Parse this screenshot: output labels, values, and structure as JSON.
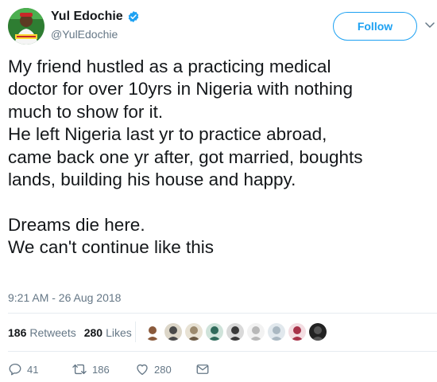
{
  "tweet": {
    "display_name": "Yul Edochie",
    "handle": "@YulEdochie",
    "verified": true,
    "follow_label": "Follow",
    "text": "My friend hustled as a practicing medical\ndoctor for over 10yrs in Nigeria with nothing\nmuch to show for it.\nHe left Nigeria last yr to practice abroad,\ncame back one yr after, got married, boughts\nlands, building his house and happy.\n\nDreams die here.\nWe can't continue like this",
    "timestamp": "9:21 AM - 26 Aug 2018"
  },
  "stats": {
    "retweets_count": "186",
    "retweets_label": "Retweets",
    "likes_count": "280",
    "likes_label": "Likes"
  },
  "likers": [
    {
      "icon": "liker-avatar-1",
      "color": "#8a5a3c"
    },
    {
      "icon": "liker-avatar-2",
      "color": "#4a4a4a"
    },
    {
      "icon": "liker-avatar-3",
      "color": "#9c8a6e"
    },
    {
      "icon": "liker-avatar-4",
      "color": "#2f6a5a"
    },
    {
      "icon": "liker-avatar-5",
      "color": "#3a3a3a"
    },
    {
      "icon": "liker-avatar-6",
      "color": "#b8b8b8"
    },
    {
      "icon": "liker-avatar-7",
      "color": "#aab8c2"
    },
    {
      "icon": "liker-avatar-8",
      "color": "#a8334a"
    },
    {
      "icon": "liker-avatar-9",
      "color": "#222222"
    }
  ],
  "actions": {
    "replies": "41",
    "retweets": "186",
    "likes": "280"
  },
  "colors": {
    "accent": "#1da1f2",
    "verified": "#1da1f2",
    "muted": "#657786",
    "text": "#14171a",
    "divider": "#e6ecf0"
  }
}
